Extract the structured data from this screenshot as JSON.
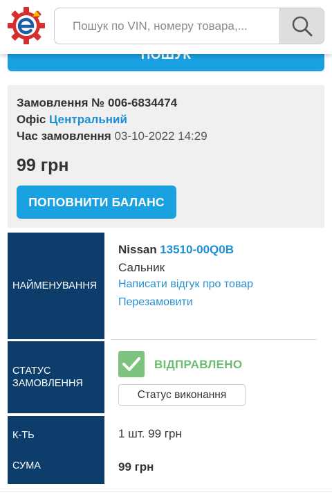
{
  "header": {
    "search_placeholder": "Пошук по VIN, номеру товара,...",
    "logo_letter": "е"
  },
  "top_button_label": "ПОШУК",
  "order": {
    "number_label": "Замовлення №",
    "number_value": "006-6834474",
    "office_label": "Офіс",
    "office_value": "Центральний",
    "time_label": "Час замовлення",
    "time_value": "03-10-2022 14:29",
    "price": "99 грн",
    "balance_button": "ПОПОВНИТИ БАЛАНС"
  },
  "table": {
    "name_header": "НАЙМЕНУВАННЯ",
    "status_header_line1": "СТАТУС",
    "status_header_line2": "ЗАМОВЛЕННЯ",
    "qty_header": "К-ТЬ",
    "sum_header": "СУМА",
    "brand": "Nissan",
    "part_number": "13510-00Q0B",
    "part_name": "Сальник",
    "review_link": "Написати відгук про товар",
    "reorder_link": "Перезамовити",
    "status_value": "ВІДПРАВЛЕНО",
    "status_button": "Статус виконання",
    "qty_value": "1 шт. 99 грн",
    "sum_value": "99 грн"
  },
  "colors": {
    "accent": "#19a1e2",
    "table_header": "#0d3d6b",
    "status_green": "#6dbb6e",
    "link": "#1e8ed1",
    "logo_red": "#d62d2d",
    "logo_blue": "#1a5ea8"
  }
}
